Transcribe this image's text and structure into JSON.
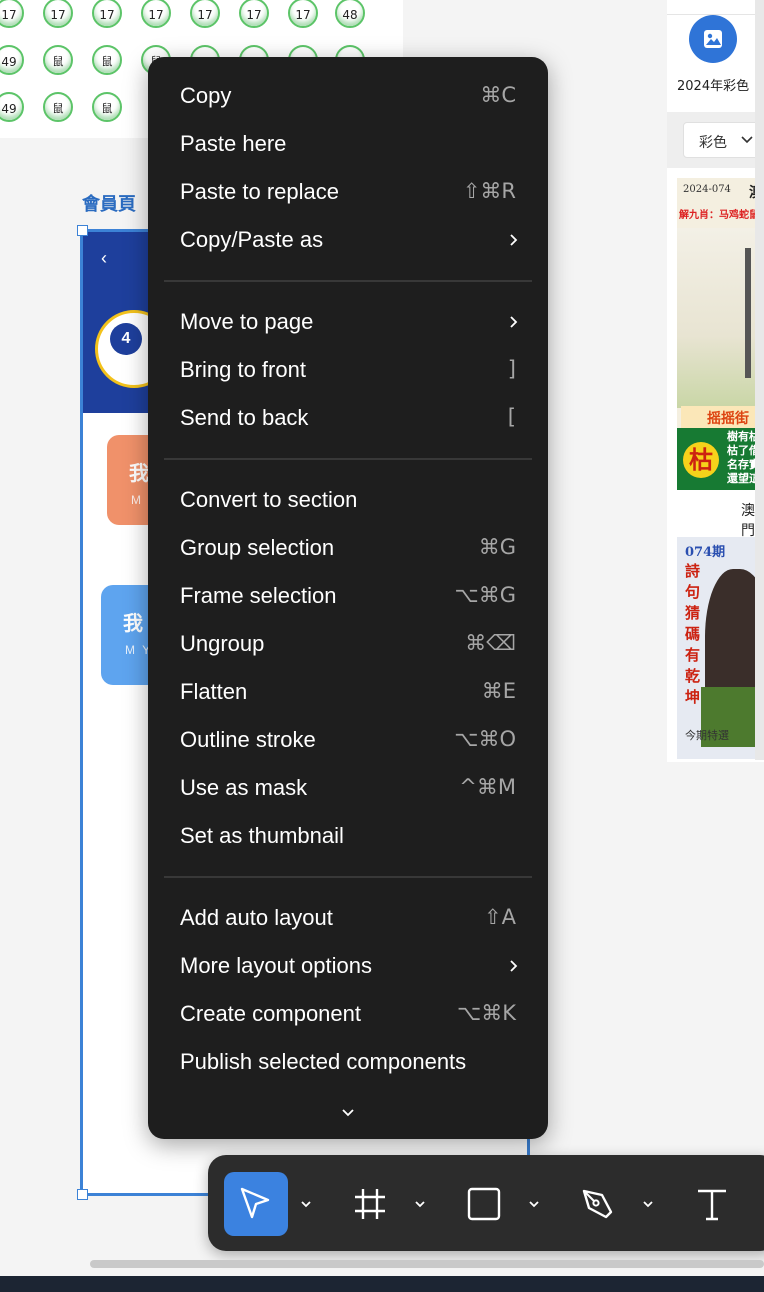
{
  "canvas": {
    "balls": {
      "row1": [
        "17",
        "17",
        "17",
        "17",
        "17",
        "17",
        "17",
        "48"
      ],
      "row2": [
        "49",
        "鼠",
        "鼠",
        "鼠"
      ],
      "row3": [
        "49",
        "鼠",
        "鼠"
      ]
    },
    "member_label": "會員頁",
    "card_orange": {
      "title": "我",
      "sub": "M Y"
    },
    "card_blue": {
      "title": "我",
      "sub": "M Y"
    }
  },
  "right_panel": {
    "image_button_label": "2024年彩色",
    "filter_value": "彩色",
    "thumb1": {
      "date": "2024-074",
      "corner_char": "澳",
      "red_line": "解九肖：马鸡蛇鼠猪狗",
      "tag_text": "摇摇街",
      "big_char": "枯",
      "side_text": [
        "樹有枯",
        "枯了借",
        "名存實",
        "還望這"
      ],
      "caption": "澳門"
    },
    "thumb2": {
      "top": "074期",
      "column": [
        "詩",
        "句",
        "猜",
        "碼",
        "有",
        "乾",
        "坤"
      ],
      "bottom": "今期特選"
    }
  },
  "menu": {
    "items": [
      {
        "label": "Copy",
        "shortcut": "⌘C"
      },
      {
        "label": "Paste here",
        "shortcut": ""
      },
      {
        "label": "Paste to replace",
        "shortcut": "⇧⌘R"
      },
      {
        "label": "Copy/Paste as",
        "shortcut": "",
        "submenu": true
      },
      {
        "label": "Move to page",
        "shortcut": "",
        "submenu": true
      },
      {
        "label": "Bring to front",
        "shortcut": "]"
      },
      {
        "label": "Send to back",
        "shortcut": "["
      },
      {
        "label": "Convert to section",
        "shortcut": ""
      },
      {
        "label": "Group selection",
        "shortcut": "⌘G"
      },
      {
        "label": "Frame selection",
        "shortcut": "⌥⌘G"
      },
      {
        "label": "Ungroup",
        "shortcut": "⌘⌫"
      },
      {
        "label": "Flatten",
        "shortcut": "⌘E"
      },
      {
        "label": "Outline stroke",
        "shortcut": "⌥⌘O"
      },
      {
        "label": "Use as mask",
        "shortcut": "^⌘M"
      },
      {
        "label": "Set as thumbnail",
        "shortcut": ""
      },
      {
        "label": "Add auto layout",
        "shortcut": "⇧A"
      },
      {
        "label": "More layout options",
        "shortcut": "",
        "submenu": true
      },
      {
        "label": "Create component",
        "shortcut": "⌥⌘K"
      },
      {
        "label": "Publish selected components",
        "shortcut": ""
      }
    ]
  },
  "toolbar": {
    "tools": [
      {
        "icon": "move-cursor-icon",
        "active": true
      },
      {
        "icon": "frame-hash-icon",
        "active": false
      },
      {
        "icon": "rectangle-icon",
        "active": false
      },
      {
        "icon": "pen-icon",
        "active": false
      },
      {
        "icon": "text-icon",
        "active": false
      }
    ]
  },
  "colors": {
    "menu_bg": "#1e1e1e",
    "accent": "#3b82e0",
    "selection": "#3c82d6"
  }
}
